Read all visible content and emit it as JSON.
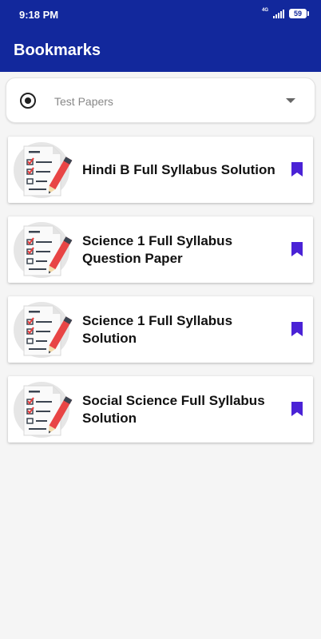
{
  "status_bar": {
    "time": "9:18 PM",
    "network": "4G",
    "battery": "59",
    "signal_icon": "signal-icon",
    "battery_icon": "battery-icon"
  },
  "app_bar": {
    "title": "Bookmarks"
  },
  "filter": {
    "selected": "Test Papers",
    "radio_icon": "radio-icon",
    "dropdown_icon": "chevron-down-icon"
  },
  "bookmarks": [
    {
      "title": "Hindi B Full Syllabus Solution",
      "icon": "test-paper-icon",
      "bookmark_icon": "bookmark-icon"
    },
    {
      "title": "Science 1 Full Syllabus Question Paper",
      "icon": "test-paper-icon",
      "bookmark_icon": "bookmark-icon"
    },
    {
      "title": "Science 1 Full Syllabus Solution",
      "icon": "test-paper-icon",
      "bookmark_icon": "bookmark-icon"
    },
    {
      "title": "Social Science Full Syllabus Solution",
      "icon": "test-paper-icon",
      "bookmark_icon": "bookmark-icon"
    }
  ],
  "colors": {
    "primary": "#12289c",
    "bookmark": "#4a22d6",
    "background": "#f5f5f5"
  }
}
